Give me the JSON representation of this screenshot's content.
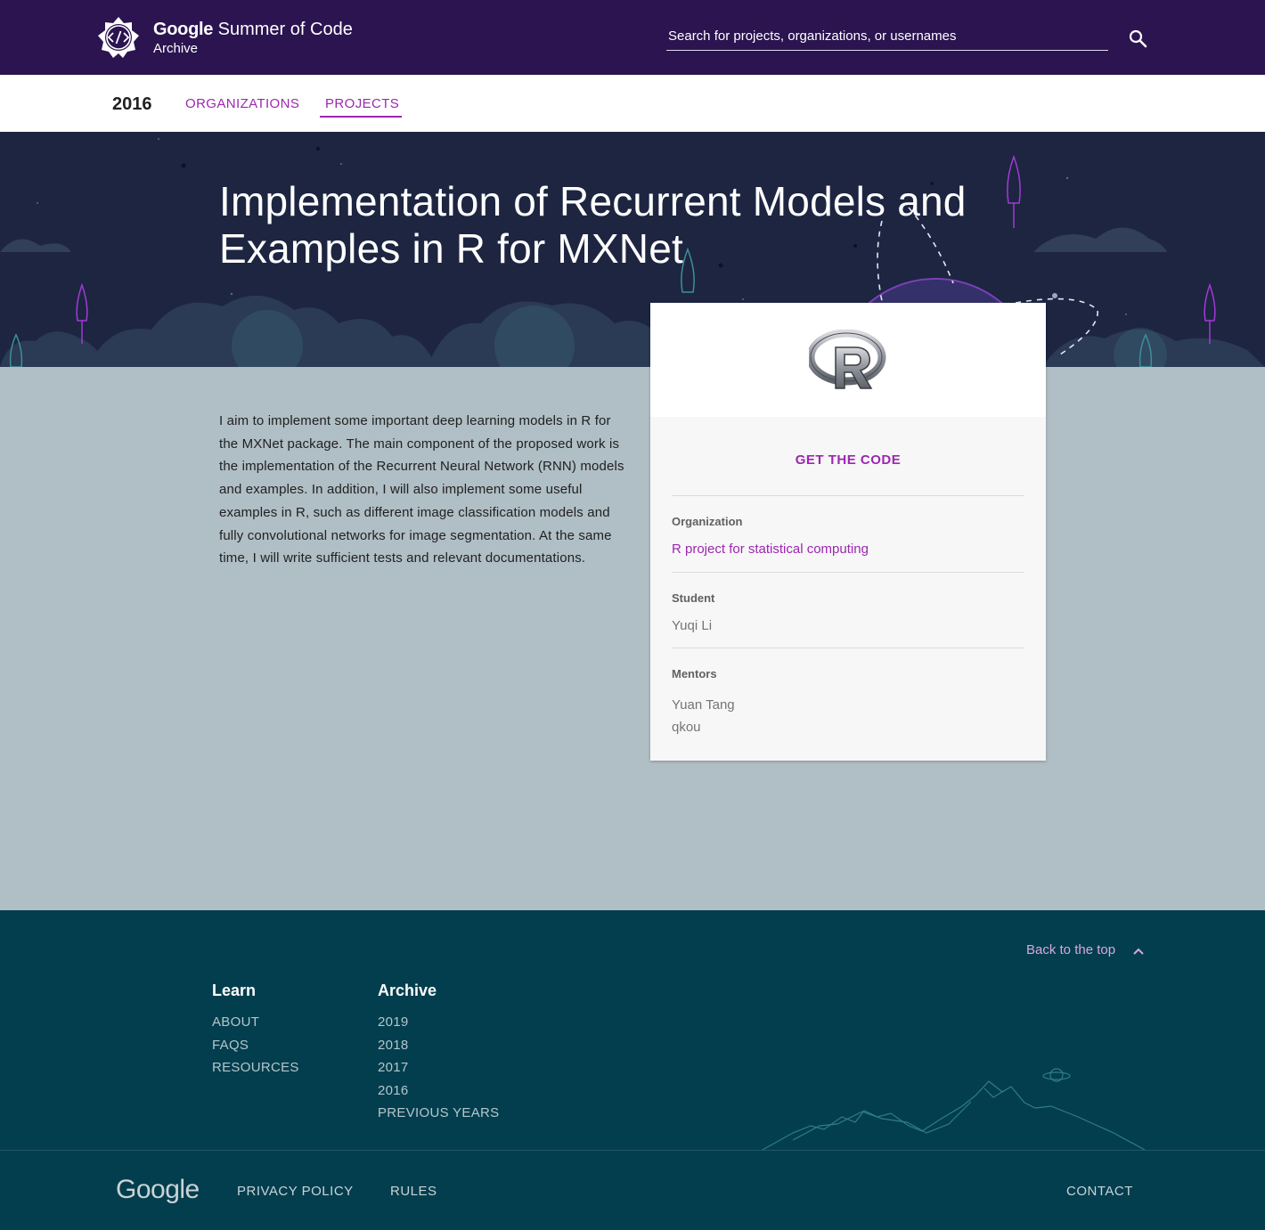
{
  "header": {
    "brand_google": "Google",
    "brand_rest": " Summer of Code",
    "brand_sub": "Archive",
    "search_placeholder": "Search for projects, organizations, or usernames"
  },
  "subnav": {
    "year": "2016",
    "tabs": [
      {
        "label": "ORGANIZATIONS",
        "active": false
      },
      {
        "label": "PROJECTS",
        "active": true
      }
    ]
  },
  "project": {
    "title": "Implementation of Recurrent Models and Examples in R for MXNet",
    "description": "I aim to implement some important deep learning models in R for the MXNet package. The main component of the proposed work is the implementation of the Recurrent Neural Network (RNN) models and examples. In addition, I will also implement some useful examples in R, such as different image classification models and fully convolutional networks for image segmentation. At the same time, I will write sufficient tests and relevant documentations."
  },
  "card": {
    "get_code": "GET THE CODE",
    "organization_label": "Organization",
    "organization": "R project for statistical computing",
    "student_label": "Student",
    "student": "Yuqi Li",
    "mentors_label": "Mentors",
    "mentors": [
      "Yuan Tang",
      "qkou"
    ]
  },
  "footer": {
    "back_to_top": "Back to the top",
    "learn_heading": "Learn",
    "learn_links": [
      "ABOUT",
      "FAQS",
      "RESOURCES"
    ],
    "archive_heading": "Archive",
    "archive_links": [
      "2019",
      "2018",
      "2017",
      "2016",
      "PREVIOUS YEARS"
    ],
    "google": "Google",
    "privacy": "PRIVACY POLICY",
    "rules": "RULES",
    "contact": "CONTACT"
  },
  "colors": {
    "header_bg": "#2b1450",
    "accent": "#9c27b0",
    "page_bg": "#b0bec5",
    "hero_bg": "#1d2541",
    "footer_bg": "#033e4e"
  },
  "icons": {
    "logo": "gsoc-logo-icon",
    "search": "search-icon",
    "back_to_top": "chevron-up-icon",
    "org_logo": "r-logo"
  }
}
